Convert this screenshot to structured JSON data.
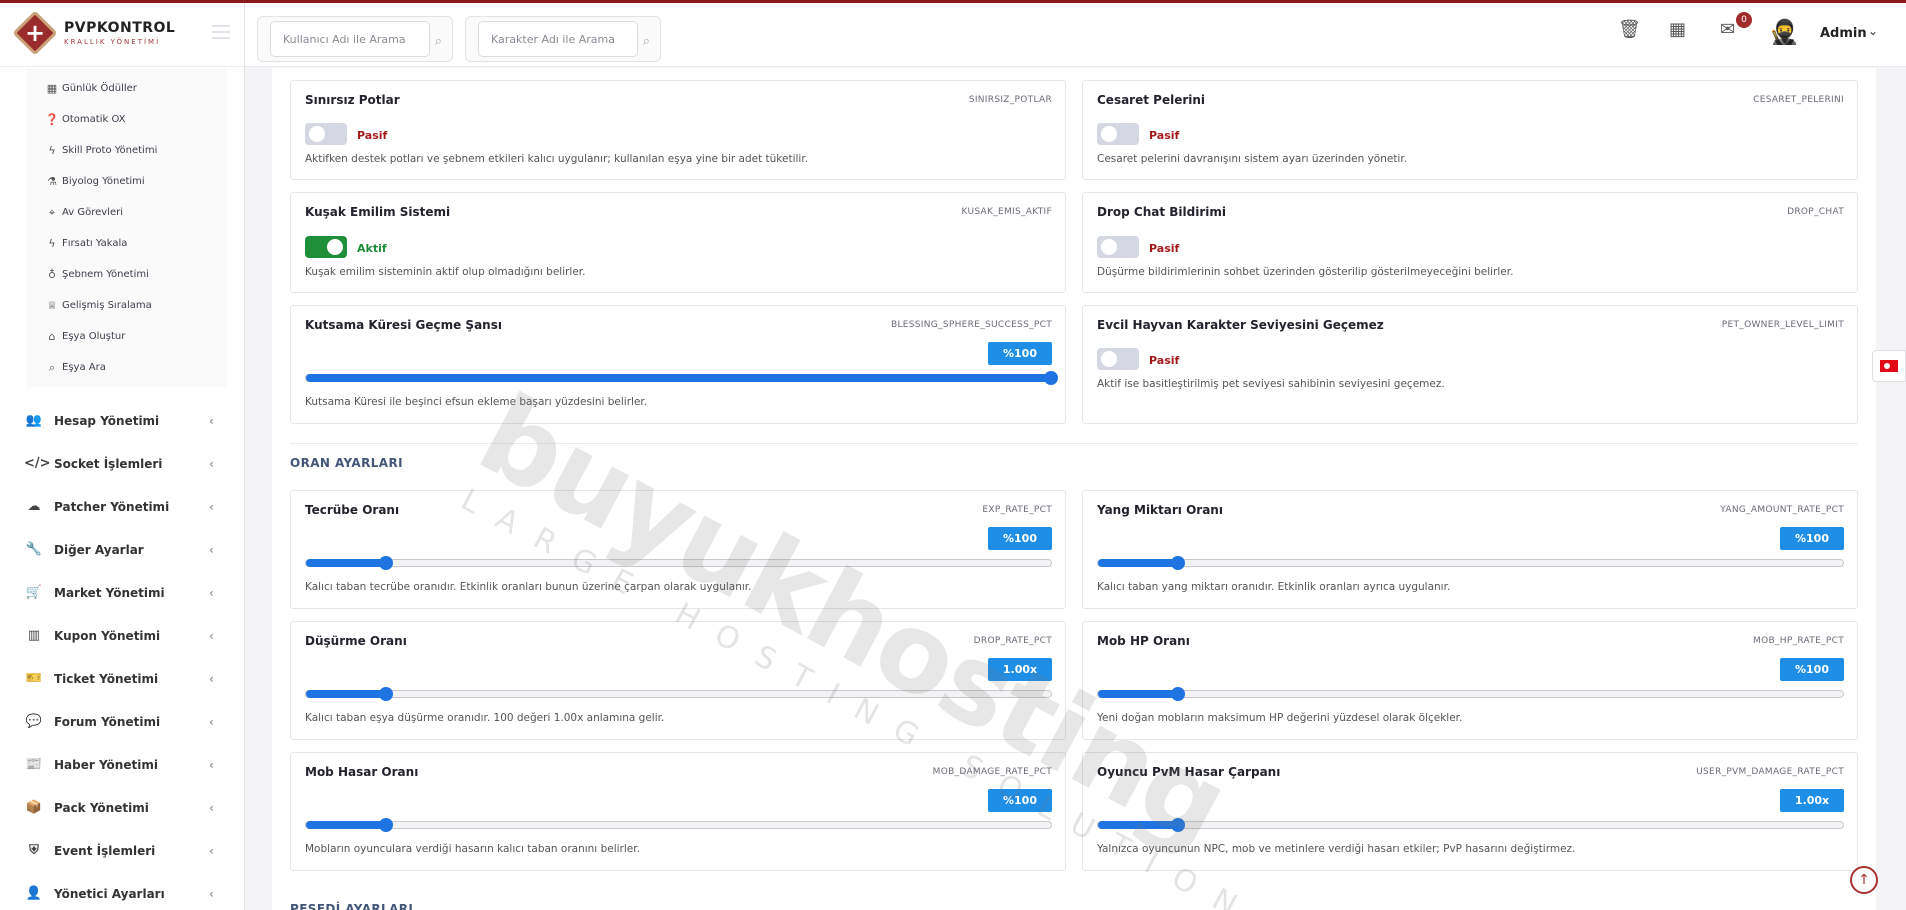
{
  "brand": {
    "title": "PVPKONTROL",
    "subtitle": "KRALLIK YÖNETİMİ"
  },
  "sidebar": {
    "submenu": [
      {
        "label": "Günlük Ödüller",
        "icon": "calendar-icon"
      },
      {
        "label": "Otomatik OX",
        "icon": "question-circle-icon"
      },
      {
        "label": "Skill Proto Yönetimi",
        "icon": "bolt-icon"
      },
      {
        "label": "Biyolog Yönetimi",
        "icon": "flask-icon"
      },
      {
        "label": "Av Görevleri",
        "icon": "crosshair-icon"
      },
      {
        "label": "Fırsatı Yakala",
        "icon": "bolt-icon"
      },
      {
        "label": "Şebnem Yönetimi",
        "icon": "potion-icon"
      },
      {
        "label": "Gelişmiş Sıralama",
        "icon": "trophy-icon"
      },
      {
        "label": "Eşya Oluştur",
        "icon": "gift-icon"
      },
      {
        "label": "Eşya Ara",
        "icon": "search-icon"
      }
    ],
    "menu": [
      {
        "label": "Hesap Yönetimi",
        "icon": "users-icon"
      },
      {
        "label": "Socket İşlemleri",
        "icon": "code-icon"
      },
      {
        "label": "Patcher Yönetimi",
        "icon": "cloud-upload-icon"
      },
      {
        "label": "Diğer Ayarlar",
        "icon": "wrench-icon"
      },
      {
        "label": "Market Yönetimi",
        "icon": "cart-icon"
      },
      {
        "label": "Kupon Yönetimi",
        "icon": "barcode-icon"
      },
      {
        "label": "Ticket Yönetimi",
        "icon": "ticket-icon"
      },
      {
        "label": "Forum Yönetimi",
        "icon": "comments-icon"
      },
      {
        "label": "Haber Yönetimi",
        "icon": "newspaper-icon"
      },
      {
        "label": "Pack Yönetimi",
        "icon": "box-icon"
      },
      {
        "label": "Event İşlemleri",
        "icon": "shield-icon"
      },
      {
        "label": "Yönetici Ayarları",
        "icon": "user-shield-icon"
      }
    ]
  },
  "header": {
    "search_user_placeholder": "Kullanıcı Adı ile Arama",
    "search_char_placeholder": "Karakter Adı ile Arama",
    "notification_count": "0",
    "admin_name": "Admin"
  },
  "toggles": [
    {
      "title": "Sınırsız Potlar",
      "key": "SINIRSIZ_POTLAR",
      "status": "Pasif",
      "active": false,
      "desc": "Aktifken destek potları ve şebnem etkileri kalıcı uygulanır; kullanılan eşya yine bir adet tüketilir."
    },
    {
      "title": "Cesaret Pelerini",
      "key": "CESARET_PELERINI",
      "status": "Pasif",
      "active": false,
      "desc": "Cesaret pelerini davranışını sistem ayarı üzerinden yönetir."
    },
    {
      "title": "Kuşak Emilim Sistemi",
      "key": "KUSAK_EMIS_AKTIF",
      "status": "Aktif",
      "active": true,
      "desc": "Kuşak emilim sisteminin aktif olup olmadığını belirler."
    },
    {
      "title": "Drop Chat Bildirimi",
      "key": "DROP_CHAT",
      "status": "Pasif",
      "active": false,
      "desc": "Düşürme bildirimlerinin sohbet üzerinden gösterilip gösterilmeyeceğini belirler."
    },
    {
      "title": "Evcil Hayvan Karakter Seviyesini Geçemez",
      "key": "PET_OWNER_LEVEL_LIMIT",
      "status": "Pasif",
      "active": false,
      "desc": "Aktif ise basitleştirilmiş pet seviyesi sahibinin seviyesini geçemez."
    }
  ],
  "blessing": {
    "title": "Kutsama Küresi Geçme Şansı",
    "key": "BLESSING_SPHERE_SUCCESS_PCT",
    "value": "%100",
    "level": 1.0,
    "desc": "Kutsama Küresi ile beşinci efsun ekleme başarı yüzdesini belirler."
  },
  "sections": {
    "rates": "ORAN AYARLARI",
    "next": "PEŞEDİ AYARLARI"
  },
  "rates": [
    {
      "title": "Tecrübe Oranı",
      "key": "EXP_RATE_PCT",
      "value": "%100",
      "level": 0.107,
      "desc": "Kalıcı taban tecrübe oranıdır. Etkinlik oranları bunun üzerine çarpan olarak uygulanır."
    },
    {
      "title": "Yang Miktarı Oranı",
      "key": "YANG_AMOUNT_RATE_PCT",
      "value": "%100",
      "level": 0.107,
      "desc": "Kalıcı taban yang miktarı oranıdır. Etkinlik oranları ayrıca uygulanır."
    },
    {
      "title": "Düşürme Oranı",
      "key": "DROP_RATE_PCT",
      "value": "1.00x",
      "level": 0.107,
      "desc": "Kalıcı taban eşya düşürme oranıdır. 100 değeri 1.00x anlamına gelir."
    },
    {
      "title": "Mob HP Oranı",
      "key": "MOB_HP_RATE_PCT",
      "value": "%100",
      "level": 0.107,
      "desc": "Yeni doğan mobların maksimum HP değerini yüzdesel olarak ölçekler."
    },
    {
      "title": "Mob Hasar Oranı",
      "key": "MOB_DAMAGE_RATE_PCT",
      "value": "%100",
      "level": 0.107,
      "desc": "Mobların oyunculara verdiği hasarın kalıcı taban oranını belirler."
    },
    {
      "title": "Oyuncu PvM Hasar Çarpanı",
      "key": "USER_PVM_DAMAGE_RATE_PCT",
      "value": "1.00x",
      "level": 0.107,
      "desc": "Yalnızca oyuncunun NPC, mob ve metinlere verdiği hasarı etkiler; PvP hasarını değiştirmez."
    }
  ],
  "watermark": {
    "main": "buyukhosting",
    "sub": "LARGE HOSTING SOLUTIONS"
  },
  "colors": {
    "accent": "#1e74e3",
    "brand": "#9b2c2c",
    "active": "#1f8f3a",
    "inactive": "#a11c1c"
  }
}
